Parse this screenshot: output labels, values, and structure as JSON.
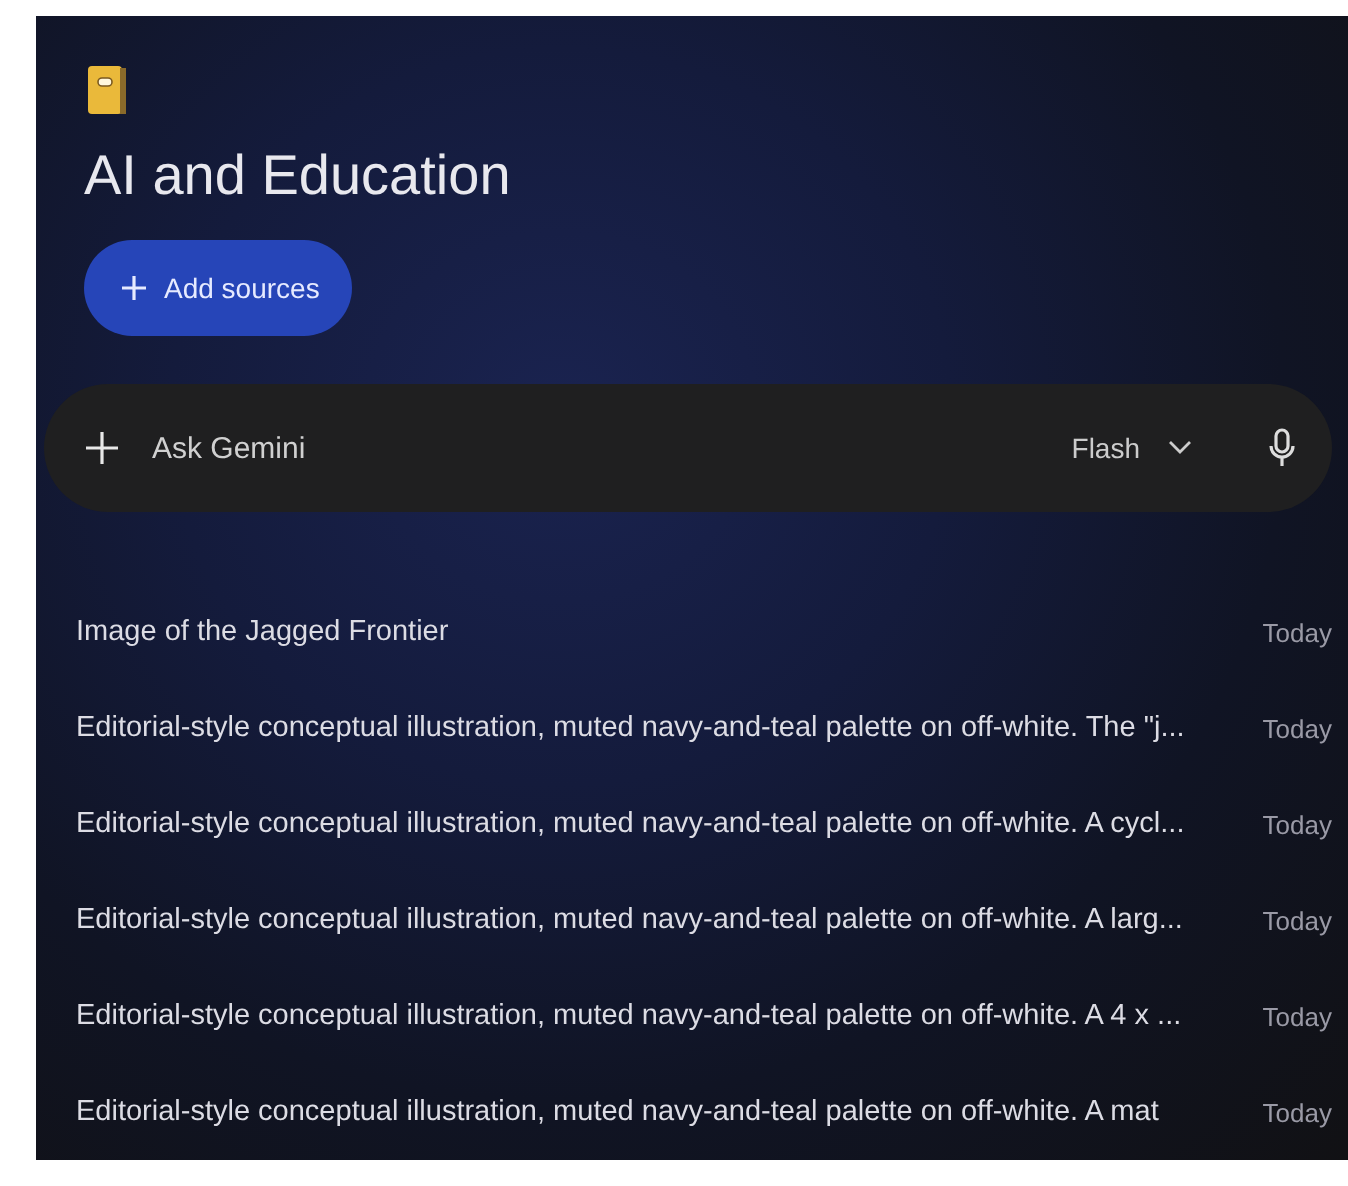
{
  "notebook": {
    "title": "AI and Education"
  },
  "add_sources_button": {
    "label": "Add sources"
  },
  "ask_bar": {
    "placeholder": "Ask Gemini",
    "model": "Flash"
  },
  "items": [
    {
      "title": "Image of the Jagged Frontier",
      "date": "Today"
    },
    {
      "title": "Editorial-style conceptual illustration, muted navy-and-teal palette on off-white. The \"j...",
      "date": "Today"
    },
    {
      "title": "Editorial-style conceptual illustration, muted navy-and-teal palette on off-white. A cycl...",
      "date": "Today"
    },
    {
      "title": "Editorial-style conceptual illustration, muted navy-and-teal palette on off-white. A larg...",
      "date": "Today"
    },
    {
      "title": "Editorial-style conceptual illustration, muted navy-and-teal palette on off-white. A 4 x ...",
      "date": "Today"
    },
    {
      "title": "Editorial-style conceptual illustration, muted navy-and-teal palette on off-white. A mat",
      "date": "Today"
    }
  ]
}
